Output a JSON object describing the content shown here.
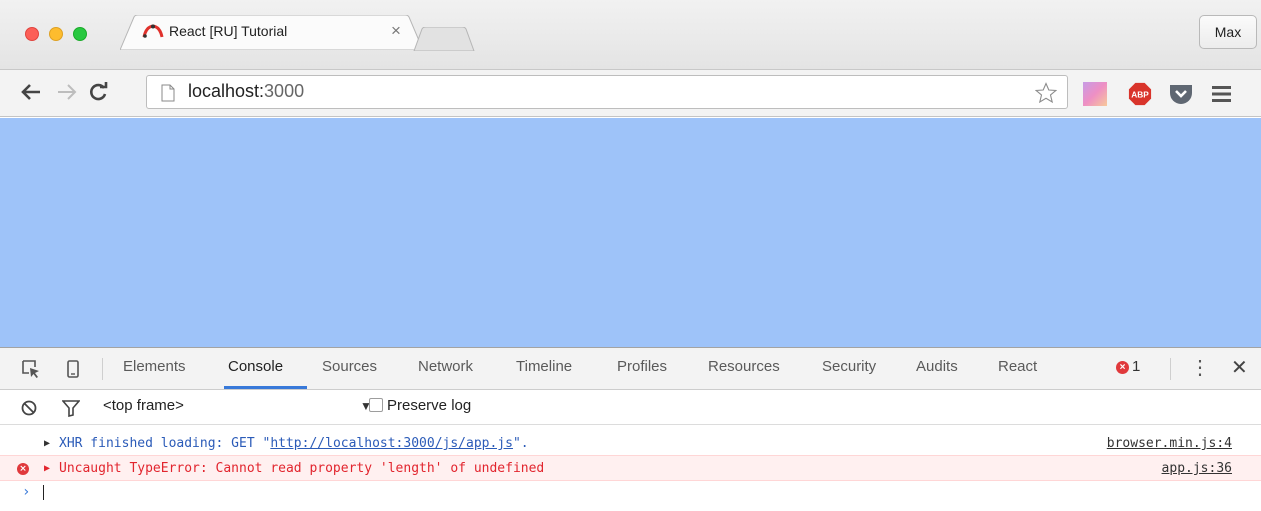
{
  "browser": {
    "tab": {
      "title": "React [RU] Tutorial",
      "close_icon": "close-icon",
      "favicon": "react-ru-icon"
    },
    "profile": "Max",
    "address": {
      "host": "localhost:",
      "port": "3000"
    },
    "extensions": [
      "color-swatch-icon",
      "adblock-plus-icon",
      "pocket-icon",
      "menu-icon"
    ],
    "page_background": "#9ec3f9"
  },
  "devtools": {
    "tabs": [
      "Elements",
      "Console",
      "Sources",
      "Network",
      "Timeline",
      "Profiles",
      "Resources",
      "Security",
      "Audits",
      "React"
    ],
    "active_tab": "Console",
    "error_count": "1",
    "filter": {
      "frame": "<top frame>",
      "preserve_log": "Preserve log"
    },
    "console": {
      "xhr": {
        "prefix": "XHR finished loading: GET \"",
        "url": "http://localhost:3000/js/app.js",
        "suffix": "\".",
        "source": "browser.min.js:4"
      },
      "error": {
        "message": "Uncaught TypeError: Cannot read property 'length' of undefined",
        "source": "app.js:36"
      },
      "prompt": "›"
    }
  }
}
